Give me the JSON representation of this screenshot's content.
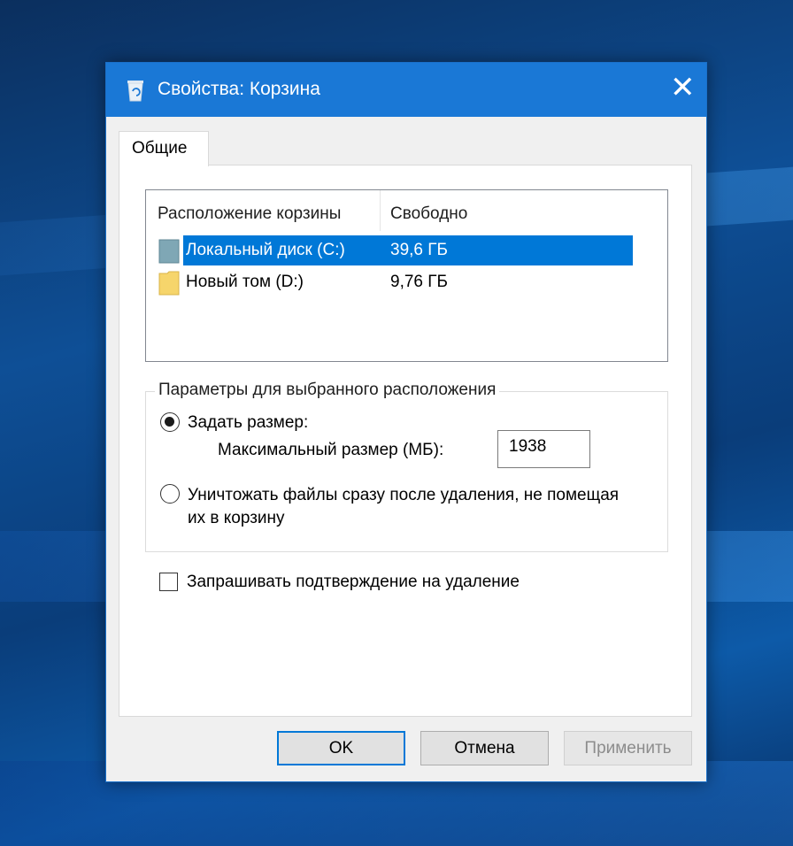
{
  "window": {
    "title": "Свойства: Корзина",
    "title_icon": "recycle-bin-icon",
    "close_icon": "close-icon",
    "close_glyph": "✕"
  },
  "tabs": [
    {
      "label": "Общие",
      "active": true
    }
  ],
  "locations": {
    "columns": [
      "Расположение корзины",
      "Свободно"
    ],
    "rows": [
      {
        "name": "Локальный диск (C:)",
        "free": "39,6 ГБ",
        "icon": "drive-c-icon",
        "selected": true
      },
      {
        "name": "Новый том (D:)",
        "free": "9,76 ГБ",
        "icon": "drive-d-icon",
        "selected": false
      }
    ]
  },
  "settings": {
    "group_label": "Параметры для выбранного расположения",
    "option_custom_size": {
      "label": "Задать размер:",
      "checked": true
    },
    "max_size_label": "Максимальный размер (МБ):",
    "max_size_value": "1938",
    "option_delete_immediately": {
      "label": "Уничтожать файлы сразу после удаления, не помещая их в корзину",
      "checked": false
    }
  },
  "confirm_delete": {
    "label": "Запрашивать подтверждение на удаление",
    "checked": false
  },
  "buttons": {
    "ok": "OK",
    "cancel": "Отмена",
    "apply": "Применить"
  },
  "colors": {
    "titlebar": "#1a78d6",
    "selection": "#0078d7",
    "drive_c": "#7fa7b5",
    "drive_d": "#f6d56b"
  }
}
